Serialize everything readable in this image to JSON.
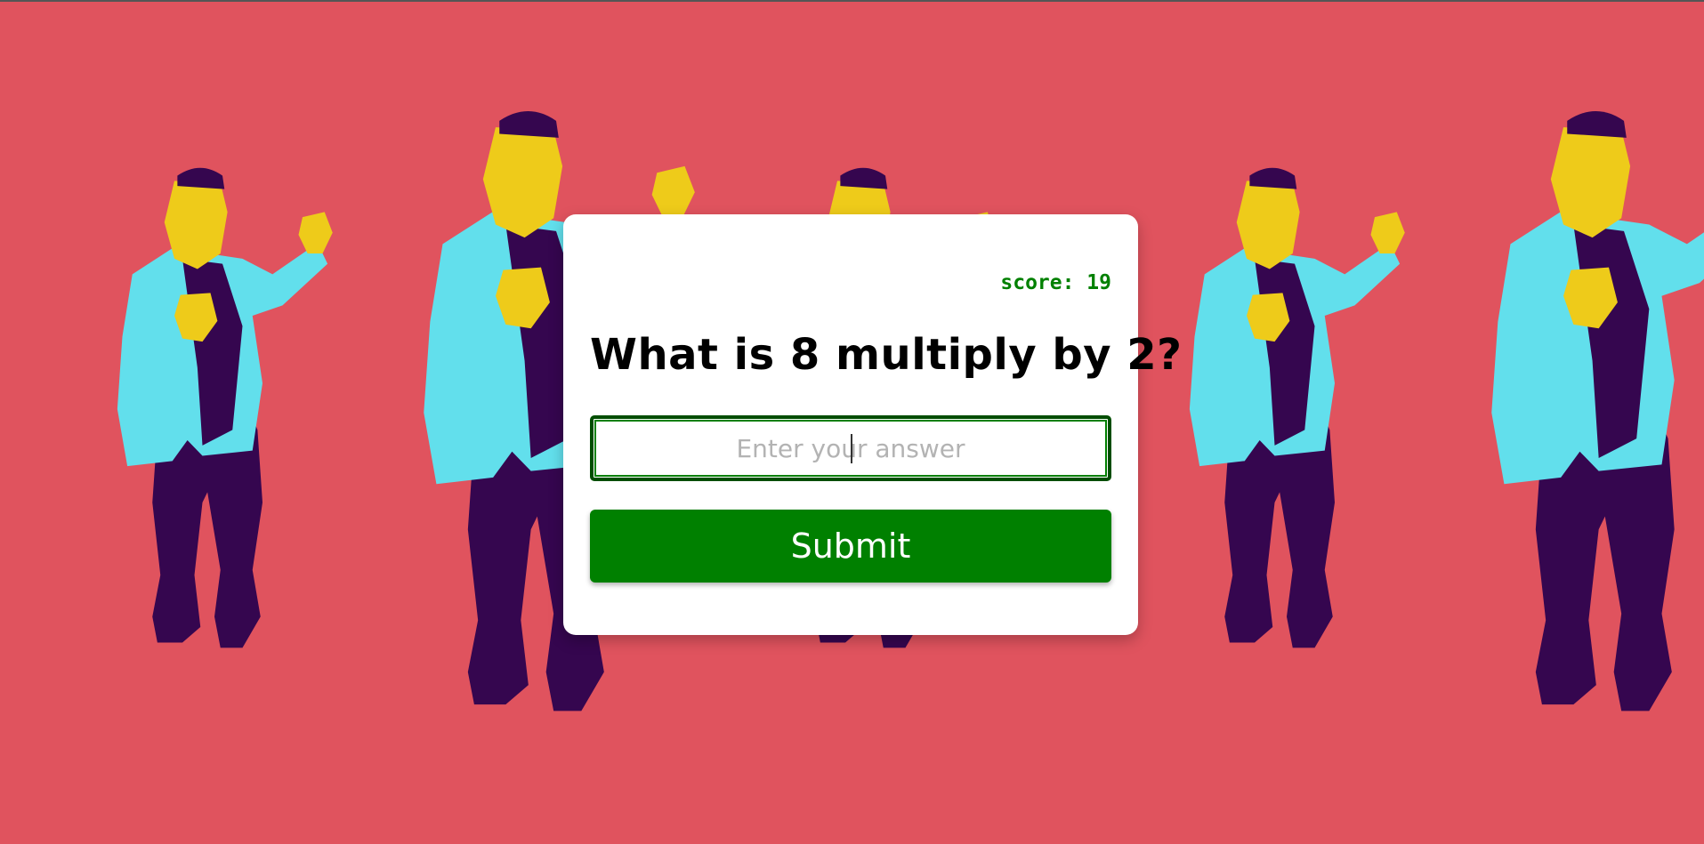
{
  "quiz": {
    "score_label": "score: 19",
    "question": "What is 8 multiply by 2?",
    "answer_placeholder": "Enter your answer",
    "answer_value": "",
    "submit_label": "Submit"
  },
  "background": {
    "color": "#e0535e",
    "figure_icon": "dancing-man-icon",
    "palette": {
      "skin": "#eecb1a",
      "shirt": "#62dfec",
      "pants": "#35064f",
      "hair": "#35064f"
    }
  },
  "colors": {
    "accent": "#008000",
    "card": "#ffffff"
  }
}
